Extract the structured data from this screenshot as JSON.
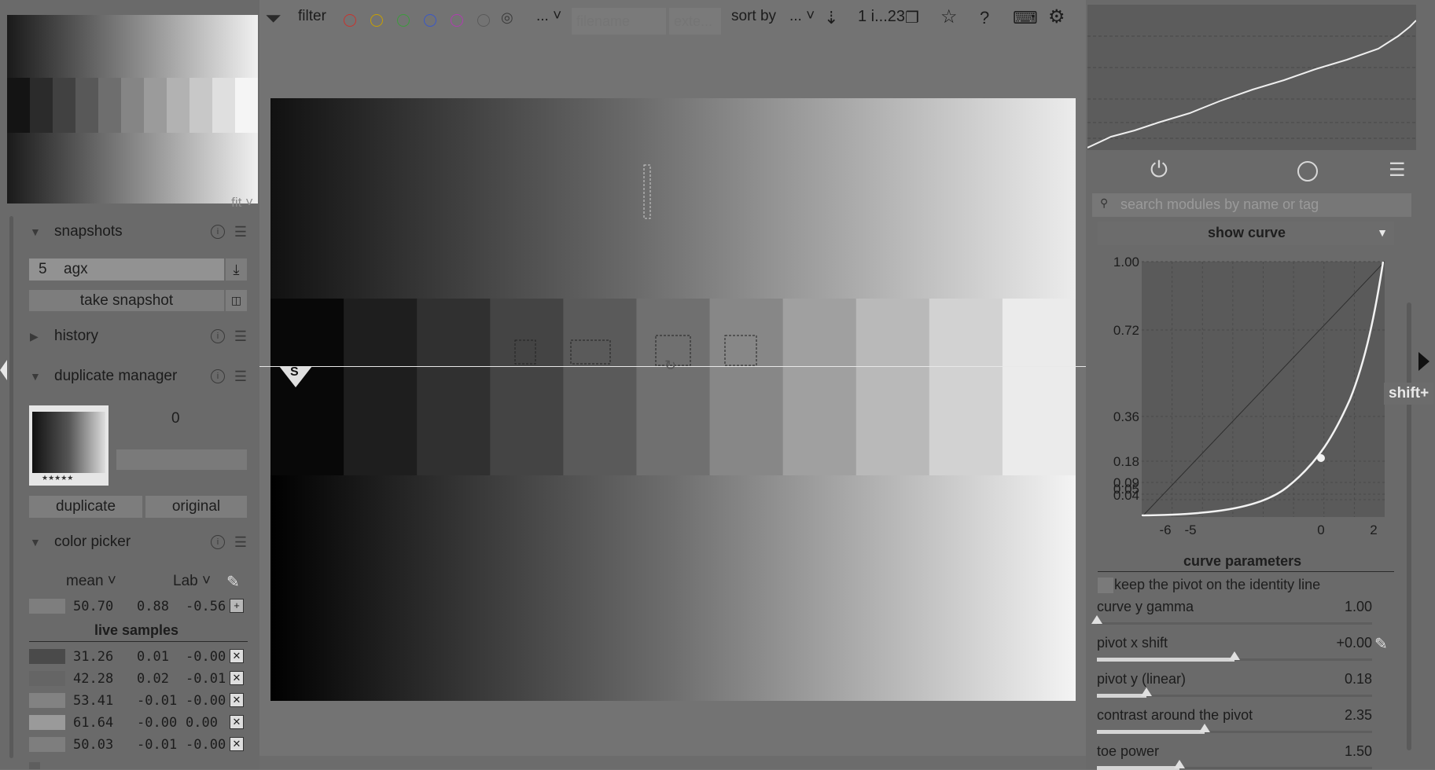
{
  "toolbar": {
    "filter_label": "filter",
    "ellipsis": "...",
    "filename_placeholder": "filename",
    "extension_placeholder": "exte...",
    "sort_by_label": "sort by",
    "sort_value": "...",
    "count_label": "1 i...23",
    "color_labels": [
      "#c8332e",
      "#c8a000",
      "#3c9c3c",
      "#3a57c8",
      "#b03cb0",
      "#5a5a5a"
    ]
  },
  "navigation": {
    "zoom_label": "fit"
  },
  "snapshots": {
    "title": "snapshots",
    "selected_number": "5",
    "selected_name": "agx",
    "take_snapshot_label": "take snapshot"
  },
  "history": {
    "title": "history"
  },
  "duplicate_manager": {
    "title": "duplicate manager",
    "version_number": "0",
    "duplicate_label": "duplicate",
    "original_label": "original",
    "thumb_stars": "★★★★★"
  },
  "color_picker": {
    "title": "color picker",
    "mode": "mean",
    "color_space": "Lab",
    "current_values": [
      "50.70",
      "0.88",
      "-0.56"
    ],
    "live_samples_title": "live samples",
    "samples": [
      {
        "color": "#4a4a4a",
        "L": "31.26",
        "a": "0.01",
        "b": "-0.00"
      },
      {
        "color": "#656565",
        "L": "42.28",
        "a": "0.02",
        "b": "-0.01"
      },
      {
        "color": "#828282",
        "L": "53.41",
        "a": "-0.01",
        "b": "-0.00"
      },
      {
        "color": "#9a9a9a",
        "L": "61.64",
        "a": "-0.00",
        "b": "0.00"
      },
      {
        "color": "#7e7e7e",
        "L": "50.03",
        "a": "-0.01",
        "b": "-0.00"
      }
    ]
  },
  "image": {
    "snapshot_marker": "S"
  },
  "module_search": {
    "placeholder": "search modules by name or tag"
  },
  "curve_module": {
    "show_curve_label": "show curve",
    "y_ticks": [
      "1.00",
      "0.72",
      "0.36",
      "0.18",
      "0.09",
      "0.05",
      "0.04"
    ],
    "x_ticks": [
      "-6",
      "-5",
      "0",
      "2"
    ],
    "curve_parameters_title": "curve parameters",
    "keep_pivot_label": "keep the pivot on the identity line",
    "tooltip": "shift+",
    "params": [
      {
        "label": "curve y gamma",
        "value": "1.00",
        "fraction": 0.0
      },
      {
        "label": "pivot x shift",
        "value": "+0.00",
        "fraction": 0.5
      },
      {
        "label": "pivot y (linear)",
        "value": "0.18",
        "fraction": 0.18
      },
      {
        "label": "contrast around the pivot",
        "value": "2.35",
        "fraction": 0.39
      },
      {
        "label": "toe power",
        "value": "1.50",
        "fraction": 0.3
      }
    ]
  }
}
